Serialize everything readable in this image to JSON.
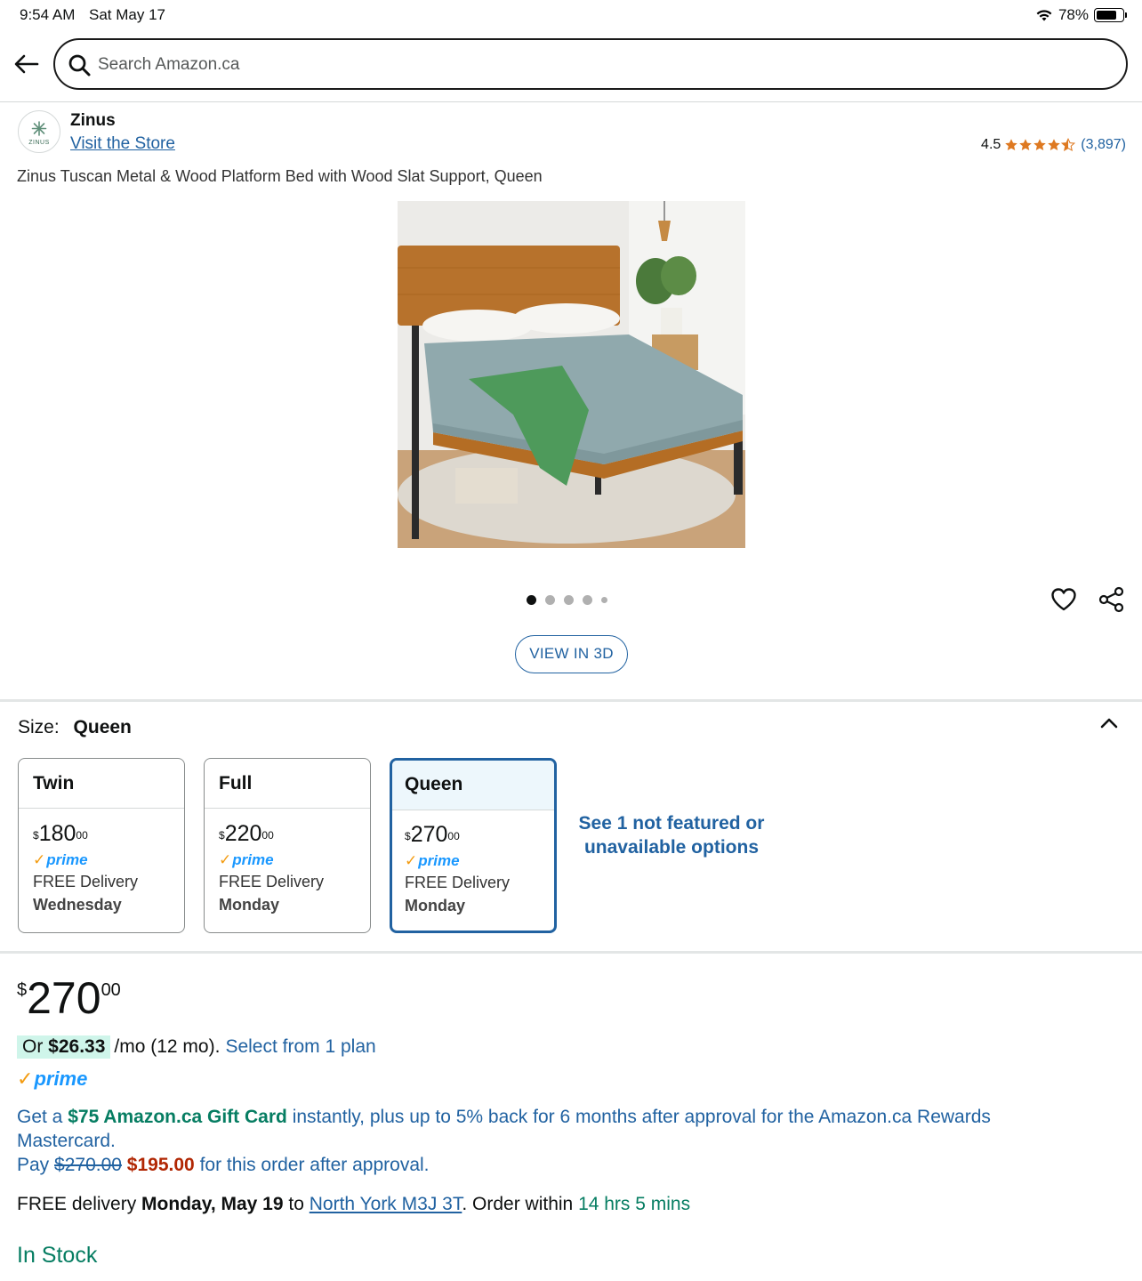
{
  "status_bar": {
    "time": "9:54 AM",
    "date": "Sat May 17",
    "battery": "78%"
  },
  "search": {
    "placeholder": "Search Amazon.ca"
  },
  "brand": {
    "name": "Zinus",
    "logo_text": "ZINUS",
    "visit_store": "Visit the Store"
  },
  "rating": {
    "value": "4.5",
    "stars": 4.5,
    "count": "(3,897)"
  },
  "product": {
    "title": "Zinus Tuscan Metal & Wood Platform Bed with Wood Slat Support, Queen",
    "image_count": 5,
    "active_image": 1,
    "view_3d": "VIEW IN 3D"
  },
  "size": {
    "label": "Size:",
    "selected": "Queen",
    "options": [
      {
        "name": "Twin",
        "currency": "$",
        "price_whole": "180",
        "price_cents": "00",
        "delivery": "FREE Delivery",
        "day": "Wednesday"
      },
      {
        "name": "Full",
        "currency": "$",
        "price_whole": "220",
        "price_cents": "00",
        "delivery": "FREE Delivery",
        "day": "Monday"
      },
      {
        "name": "Queen",
        "currency": "$",
        "price_whole": "270",
        "price_cents": "00",
        "delivery": "FREE Delivery",
        "day": "Monday"
      }
    ],
    "see_more": "See 1 not featured or unavailable options"
  },
  "prime": {
    "check": "✓",
    "text": "prime"
  },
  "price": {
    "currency": "$",
    "whole": "270",
    "cents": "00"
  },
  "monthly": {
    "or": "Or",
    "amount": "$26.33",
    "term": "/mo (12 mo).",
    "link": "Select from 1 plan"
  },
  "offer": {
    "prefix": "Get a",
    "gift": "$75 Amazon.ca Gift Card",
    "rest": "instantly, plus up to 5% back for 6 months after approval for the Amazon.ca Rewards Mastercard.",
    "pay": "Pay",
    "old_price": "$270.00",
    "new_price": "$195.00",
    "suffix": "for this order after approval."
  },
  "delivery": {
    "prefix": "FREE delivery",
    "date": "Monday, May 19",
    "to": "to",
    "address": "North York M3J 3T",
    "order_within": ". Order within",
    "countdown": "14 hrs 5 mins"
  },
  "stock": "In Stock",
  "colors": {
    "link": "#2162a1",
    "green": "#067d62",
    "red": "#b12704",
    "star": "#de7921",
    "prime_blue": "#1a98ff",
    "prime_orange": "#f39c12"
  }
}
